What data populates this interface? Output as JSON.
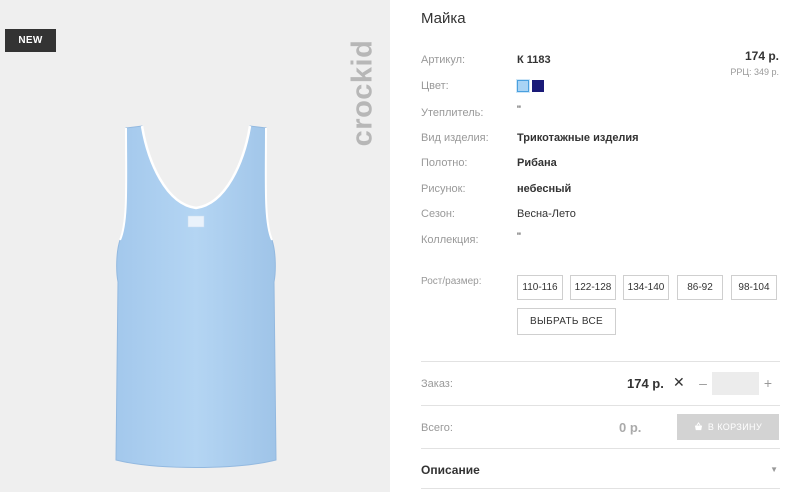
{
  "badge": {
    "new": "NEW"
  },
  "brand": {
    "logo_text": "crockid"
  },
  "product": {
    "title": "Майка",
    "price": "174 р.",
    "rrc": "РРЦ: 349 р.",
    "attributes": [
      {
        "label": "Артикул:",
        "value": "К 1183"
      },
      {
        "label": "Цвет:",
        "value": ""
      },
      {
        "label": "Утеплитель:",
        "value": "\""
      },
      {
        "label": "Вид изделия:",
        "value": "Трикотажные изделия"
      },
      {
        "label": "Полотно:",
        "value": "Рибана"
      },
      {
        "label": "Рисунок:",
        "value": "небесный"
      },
      {
        "label": "Сезон:",
        "value": "Весна-Лето"
      },
      {
        "label": "Коллекция:",
        "value": "\""
      }
    ],
    "colors": [
      "#a9d4f5",
      "#1a1a78"
    ]
  },
  "sizes": {
    "label": "Рост/размер:",
    "options": [
      "110-116",
      "122-128",
      "134-140",
      "86-92",
      "98-104"
    ],
    "select_all": "ВЫБРАТЬ ВСЕ"
  },
  "order": {
    "label": "Заказ:",
    "price": "174 р.",
    "close": "✕",
    "minus": "–",
    "plus": "+",
    "qty_value": ""
  },
  "total": {
    "label": "Всего:",
    "value": "0 р.",
    "cart_button": "В КОРЗИНУ"
  },
  "description": {
    "label": "Описание",
    "arrow": "▼"
  }
}
